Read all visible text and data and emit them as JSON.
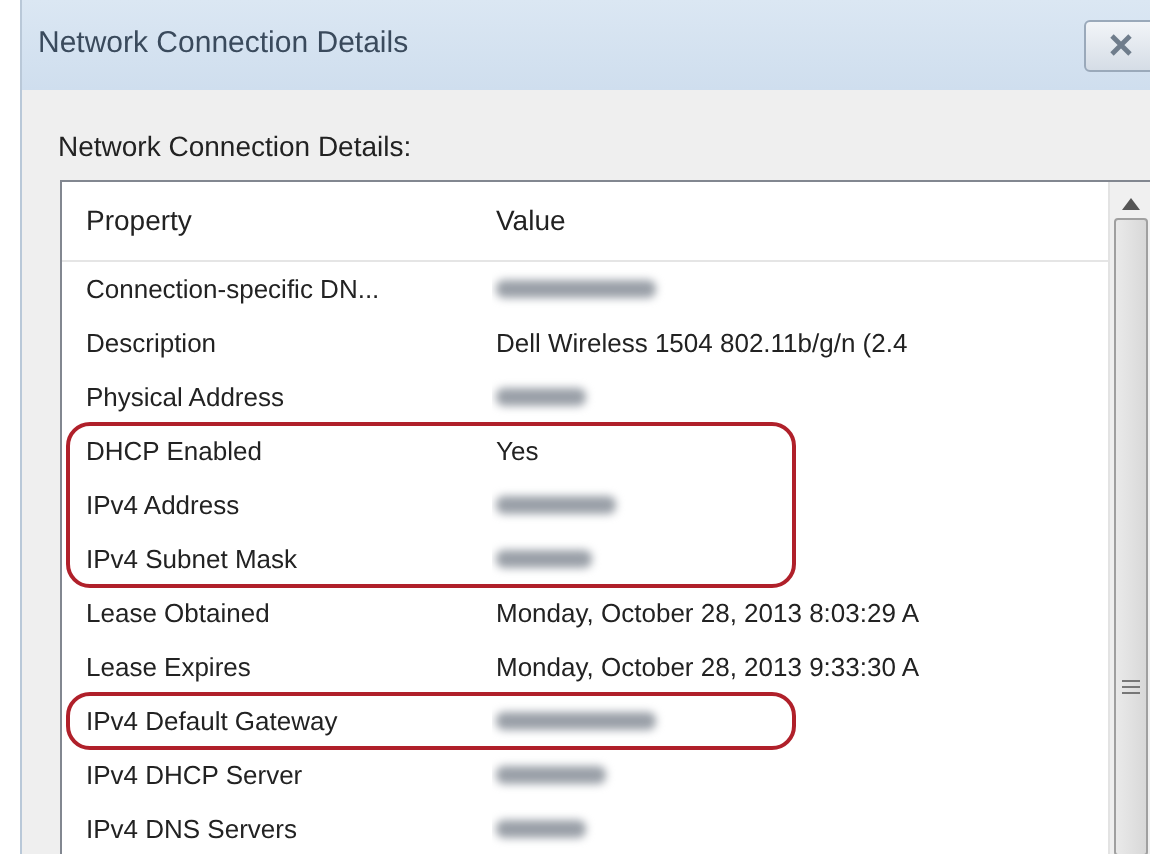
{
  "window": {
    "title": "Network Connection Details"
  },
  "label": "Network Connection Details:",
  "table": {
    "columns": [
      "Property",
      "Value"
    ],
    "rows": [
      {
        "property": "Connection-specific DN...",
        "redacted": true,
        "circled": false
      },
      {
        "property": "Description",
        "value": "Dell Wireless 1504 802.11b/g/n (2.4",
        "redacted": false,
        "circled": false
      },
      {
        "property": "Physical Address",
        "redacted": true,
        "circled": false
      },
      {
        "property": "DHCP Enabled",
        "value": "Yes",
        "redacted": false,
        "circled": true
      },
      {
        "property": "IPv4 Address",
        "redacted": true,
        "circled": true
      },
      {
        "property": "IPv4 Subnet Mask",
        "redacted": true,
        "circled": true
      },
      {
        "property": "Lease Obtained",
        "value": "Monday, October 28, 2013 8:03:29 A",
        "redacted": false,
        "circled": false
      },
      {
        "property": "Lease Expires",
        "value": "Monday, October 28, 2013 9:33:30 A",
        "redacted": false,
        "circled": false
      },
      {
        "property": "IPv4 Default Gateway",
        "redacted": true,
        "circled": true
      },
      {
        "property": "IPv4 DHCP Server",
        "redacted": true,
        "circled": false
      },
      {
        "property": "IPv4 DNS Servers",
        "redacted": true,
        "circled": false
      }
    ]
  }
}
